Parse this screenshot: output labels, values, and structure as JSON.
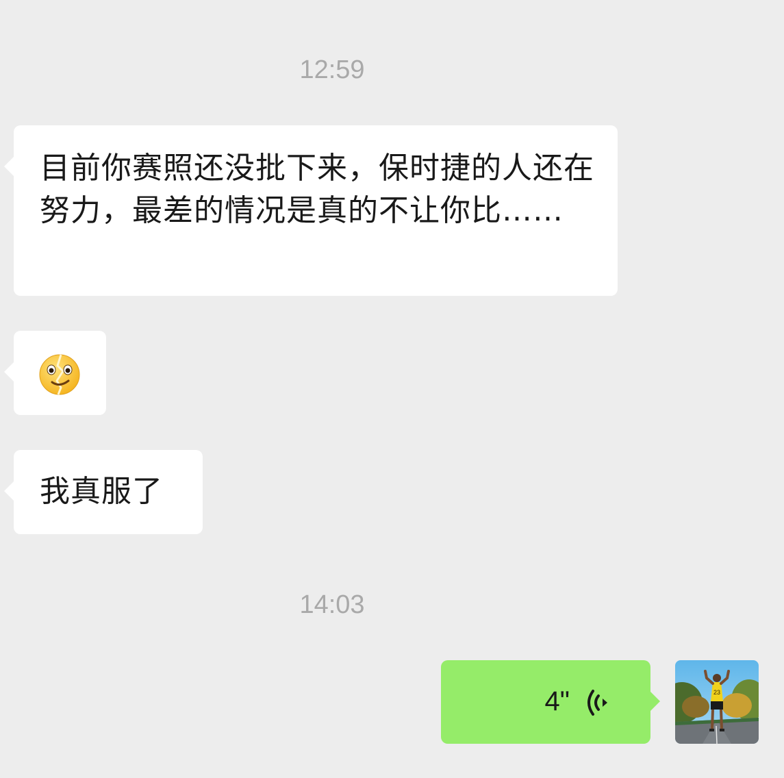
{
  "chat": {
    "timestamp_1": "12:59",
    "timestamp_2": "14:03",
    "messages": [
      {
        "type": "text",
        "direction": "incoming",
        "text": "目前你赛照还没批下来，保时捷的人还在努力，最差的情况是真的不让你比……"
      },
      {
        "type": "emoji",
        "direction": "incoming",
        "emoji": "broken-heart-smile-face"
      },
      {
        "type": "text",
        "direction": "incoming",
        "text": "我真服了"
      },
      {
        "type": "voice",
        "direction": "outgoing",
        "duration": "4\"",
        "icon": "voice-wave-icon"
      }
    ],
    "avatar": {
      "icon": "user-avatar-photo"
    },
    "colors": {
      "background": "#ededed",
      "incoming_bubble": "#ffffff",
      "outgoing_bubble": "#95ec69",
      "timestamp_text": "#a9a9a9"
    }
  }
}
